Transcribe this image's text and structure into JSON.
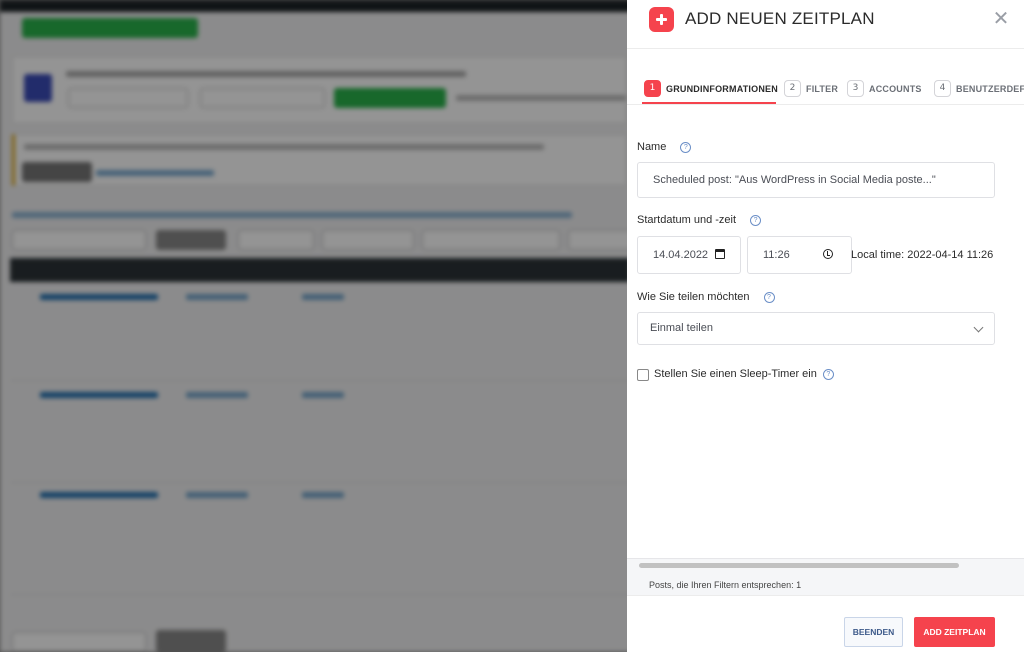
{
  "panel": {
    "title": "ADD NEUEN ZEITPLAN",
    "close_icon": "close-icon"
  },
  "tabs": [
    {
      "num": "1",
      "label": "GRUNDINFORMATIONEN",
      "active": true
    },
    {
      "num": "2",
      "label": "FILTER",
      "active": false
    },
    {
      "num": "3",
      "label": "ACCOUNTS",
      "active": false
    },
    {
      "num": "4",
      "label": "BENUTZERDEFINI",
      "active": false
    }
  ],
  "form": {
    "name_label": "Name",
    "name_value": "Scheduled post: \"Aus WordPress in Social Media poste...\"",
    "start_label": "Startdatum und -zeit",
    "date_value": "14.04.2022",
    "time_value": "11:26",
    "local_time": "Local time: 2022-04-14 11:26",
    "share_label": "Wie Sie teilen möchten",
    "share_value": "Einmal teilen",
    "sleep_timer_label": "Stellen Sie einen Sleep-Timer ein",
    "sleep_timer_checked": false
  },
  "footer": {
    "posts_count": "Posts, die Ihren Filtern entsprechen: 1",
    "cancel_label": "BEENDEN",
    "add_label": "ADD ZEITPLAN"
  },
  "colors": {
    "accent": "#f5434d",
    "overlay": "#000000",
    "help_icon": "#6b8fc7"
  },
  "icons": [
    "plus-icon",
    "close-icon",
    "help-icon",
    "calendar-icon",
    "clock-icon",
    "chevron-down-icon"
  ]
}
